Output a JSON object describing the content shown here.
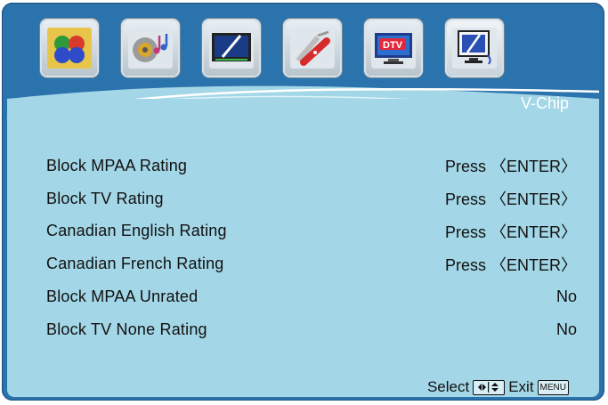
{
  "menu": {
    "section_title": "V-Chip",
    "tabs": [
      {
        "icon": "picture-icon"
      },
      {
        "icon": "audio-icon"
      },
      {
        "icon": "screen-icon"
      },
      {
        "icon": "tools-icon"
      },
      {
        "icon": "dtv-icon",
        "label": "DTV"
      },
      {
        "icon": "pc-monitor-icon"
      }
    ],
    "rows": [
      {
        "label": "Block MPAA Rating",
        "value": "Press 〈ENTER〉"
      },
      {
        "label": "Block TV Rating",
        "value": "Press 〈ENTER〉"
      },
      {
        "label": "Canadian English Rating",
        "value": "Press 〈ENTER〉"
      },
      {
        "label": "Canadian French Rating",
        "value": "Press 〈ENTER〉"
      },
      {
        "label": "Block MPAA Unrated",
        "value": "No"
      },
      {
        "label": "Block TV None Rating",
        "value": "No"
      }
    ],
    "footer": {
      "select_label": "Select",
      "exit_label": "Exit",
      "exit_key": "MENU"
    }
  },
  "colors": {
    "frame": "#2b73ad",
    "panel": "#a3d6e6",
    "text": "#111111",
    "title": "#ffffff"
  }
}
